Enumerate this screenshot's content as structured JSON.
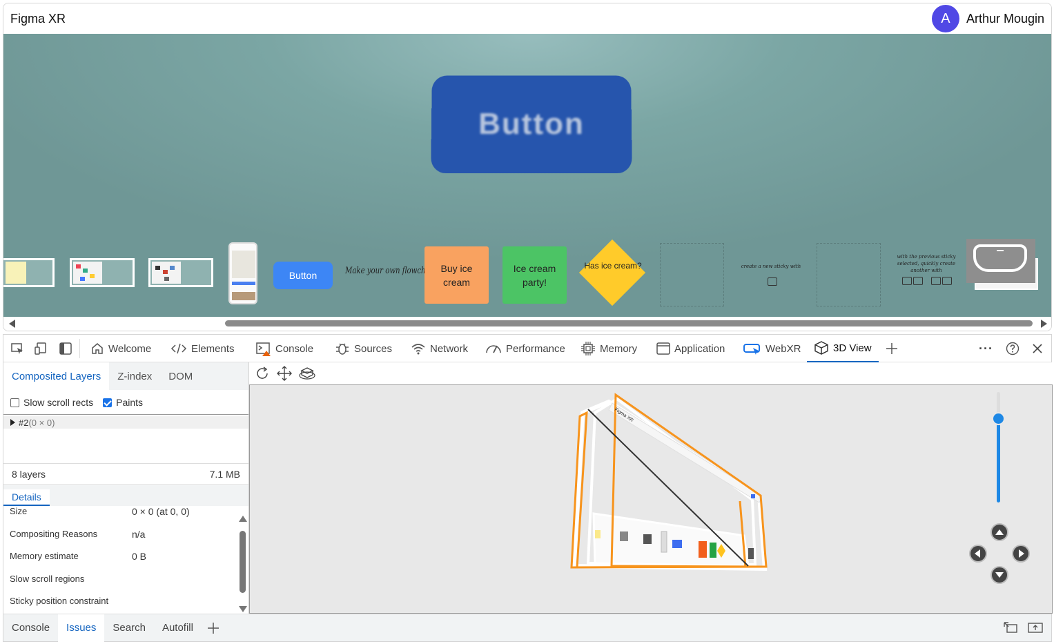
{
  "app": {
    "title": "Figma XR",
    "user_initial": "A",
    "user_name": "Arthur Mougin"
  },
  "canvas": {
    "big_button_label": "Button",
    "mini_button_label": "Button",
    "flowchart_text": "Make your own flowchart",
    "sticky_orange": "Buy ice cream",
    "sticky_green": "Ice cream party!",
    "decision": "Has ice cream?",
    "sticky_hint_1": "create a new sticky with",
    "sticky_hint_2": "with the previous sticky selected, quickly create another with",
    "colors": {
      "accent": "#2655ad",
      "orange": "#f9a260",
      "green": "#4cc465",
      "yellow": "#ffcb2a",
      "blue": "#3d86f5"
    }
  },
  "devtools": {
    "tabs": [
      {
        "label": "Welcome",
        "icon": "home-icon"
      },
      {
        "label": "Elements",
        "icon": "code-icon"
      },
      {
        "label": "Console",
        "icon": "console-icon"
      },
      {
        "label": "Sources",
        "icon": "bug-icon"
      },
      {
        "label": "Network",
        "icon": "wifi-icon"
      },
      {
        "label": "Performance",
        "icon": "gauge-icon"
      },
      {
        "label": "Memory",
        "icon": "chip-icon"
      },
      {
        "label": "Application",
        "icon": "window-icon"
      },
      {
        "label": "WebXR",
        "icon": "vr-icon"
      },
      {
        "label": "3D View",
        "icon": "cube-icon"
      }
    ],
    "active_tab": "3D View",
    "subtabs": [
      "Composited Layers",
      "Z-index",
      "DOM"
    ],
    "options": {
      "slow_scroll": "Slow scroll rects",
      "paints": "Paints",
      "paints_checked": true,
      "slow_scroll_checked": false
    },
    "tree": {
      "node": "#2",
      "dims": "(0 × 0)"
    },
    "summary": {
      "layers": "8 layers",
      "size": "7.1 MB"
    },
    "details_tab": "Details",
    "details": [
      {
        "label": "Size",
        "value": "0 × 0 (at 0, 0)"
      },
      {
        "label": "Compositing Reasons",
        "value": "n/a"
      },
      {
        "label": "Memory estimate",
        "value": "0 B"
      },
      {
        "label": "Slow scroll regions",
        "value": ""
      },
      {
        "label": "Sticky position constraint",
        "value": ""
      }
    ],
    "drawer_tabs": [
      "Console",
      "Issues",
      "Search",
      "Autofill"
    ],
    "drawer_active": "Issues",
    "zoom_level": 0.76,
    "scene_label": "Figma XR"
  }
}
